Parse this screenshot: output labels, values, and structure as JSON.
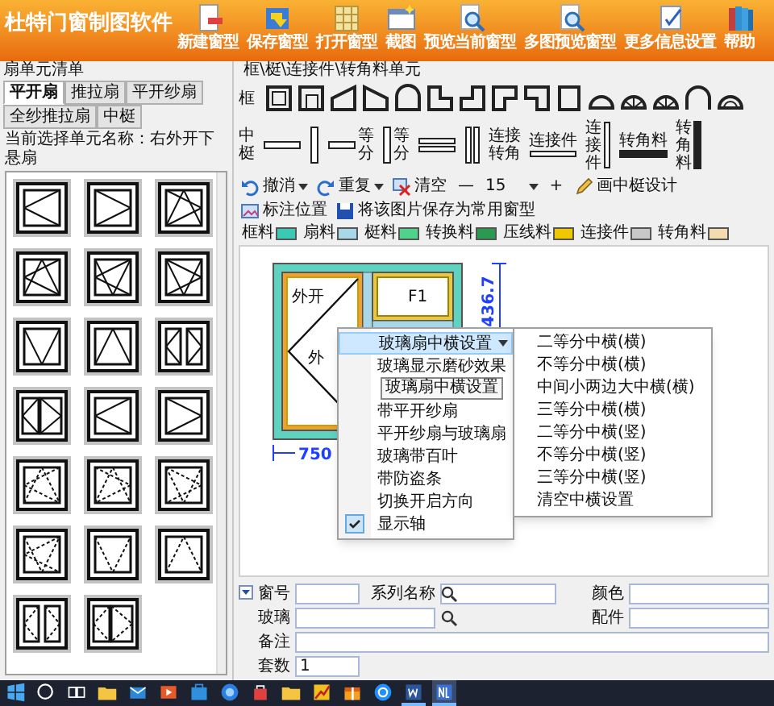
{
  "app": {
    "title": "杜特门窗制图软件"
  },
  "toolbar": [
    {
      "kind": "new",
      "label": "新建窗型"
    },
    {
      "kind": "save",
      "label": "保存窗型"
    },
    {
      "kind": "open",
      "label": "打开窗型"
    },
    {
      "kind": "screenshot",
      "label": "截图"
    },
    {
      "kind": "preview",
      "label": "预览当前窗型"
    },
    {
      "kind": "multi-preview",
      "label": "多图预览窗型"
    },
    {
      "kind": "settings",
      "label": "更多信息设置"
    },
    {
      "kind": "help",
      "label": "帮助"
    }
  ],
  "unit_panel": {
    "title": "扇单元清单",
    "tabs": [
      {
        "label": "平开扇",
        "selected": true
      },
      {
        "label": "推拉扇",
        "selected": false
      },
      {
        "label": "平开纱扇",
        "selected": false
      },
      {
        "label": "全纱推拉扇",
        "selected": false
      },
      {
        "label": "中梃",
        "selected": false
      }
    ],
    "current_unit": "当前选择单元名称：右外开下悬扇",
    "units": [
      {
        "kind": "side-left",
        "dashed": false
      },
      {
        "kind": "side-right",
        "dashed": false
      },
      {
        "kind": "tilt-right",
        "dashed": false
      },
      {
        "kind": "tilt-left",
        "dashed": false
      },
      {
        "kind": "tilt-left-b",
        "dashed": false
      },
      {
        "kind": "tilt-right-b",
        "dashed": false
      },
      {
        "kind": "bottom",
        "dashed": false
      },
      {
        "kind": "top",
        "dashed": false
      },
      {
        "kind": "double",
        "dashed": false
      },
      {
        "kind": "double-wide",
        "dashed": false
      },
      {
        "kind": "side-left",
        "dashed": false
      },
      {
        "kind": "side-right",
        "dashed": false
      },
      {
        "kind": "tilt-left",
        "dashed": true
      },
      {
        "kind": "tilt-right",
        "dashed": true
      },
      {
        "kind": "tilt-right-b",
        "dashed": true
      },
      {
        "kind": "tilt-left-b",
        "dashed": true
      },
      {
        "kind": "bottom",
        "dashed": true
      },
      {
        "kind": "top",
        "dashed": true
      },
      {
        "kind": "double",
        "dashed": true
      },
      {
        "kind": "double-wide",
        "dashed": true
      }
    ]
  },
  "parts_panel": {
    "title": "框\\梃\\连接件\\转角料单元",
    "frame_row": {
      "label": "框",
      "items": [
        {
          "kind": "rect"
        },
        {
          "kind": "rect-sill"
        },
        {
          "kind": "slope-left"
        },
        {
          "kind": "slope-right"
        },
        {
          "kind": "arch-rect"
        },
        {
          "kind": "notch-tr"
        },
        {
          "kind": "notch-tl"
        },
        {
          "kind": "notch-br"
        },
        {
          "kind": "notch-bl"
        },
        {
          "kind": "rect-tall"
        },
        {
          "kind": "half-round"
        },
        {
          "kind": "fan"
        },
        {
          "kind": "fan"
        },
        {
          "kind": "round-arch"
        },
        {
          "kind": "sunburst"
        }
      ]
    },
    "mullion_row": {
      "label": "中梃",
      "items": [
        {
          "kind": "bar-h"
        },
        {
          "kind": "bar-v"
        },
        {
          "kind": "equal-h",
          "text": "等分"
        },
        {
          "kind": "equal-v",
          "text": "等分"
        },
        {
          "kind": "double-h"
        },
        {
          "kind": "double-v"
        },
        {
          "kind": "corner-joint",
          "text": "连接转角"
        },
        {
          "kind": "connector-h",
          "text": "连接件"
        },
        {
          "kind": "connector-v",
          "text": "连接件"
        },
        {
          "kind": "corner-h",
          "text": "转角料"
        },
        {
          "kind": "corner-v",
          "text": "转角料"
        }
      ]
    }
  },
  "edit_toolbar": [
    {
      "kind": "undo",
      "label": "撤消",
      "dropdown": true
    },
    {
      "kind": "redo",
      "label": "重复",
      "dropdown": true
    },
    {
      "kind": "clear",
      "label": "清空",
      "dropdown": false
    },
    {
      "kind": "zoom",
      "minus": "—",
      "value": "15",
      "plus": "+"
    },
    {
      "kind": "design",
      "label": "画中梃设计",
      "dropdown": false
    },
    {
      "kind": "dimension",
      "label": "标注位置",
      "dropdown": false
    },
    {
      "kind": "save",
      "label": "将该图片保存为常用窗型",
      "dropdown": false
    }
  ],
  "legend": [
    {
      "label": "框料",
      "color": "#3cc9b4"
    },
    {
      "label": "扇料",
      "color": "#a8d8e8"
    },
    {
      "label": "梃料",
      "color": "#4fd28a"
    },
    {
      "label": "转换料",
      "color": "#2a9a50"
    },
    {
      "label": "压线料",
      "color": "#f0c800"
    },
    {
      "label": "连接件",
      "color": "#c8c8c8"
    },
    {
      "label": "转角料",
      "color": "#f5dcb0"
    }
  ],
  "drawing": {
    "height_dim": "436.7",
    "width_dim": "750",
    "sash_labels": [
      "外开",
      "F1",
      "外"
    ]
  },
  "context_menu": {
    "items": [
      {
        "label": "玻璃扇中横设置",
        "submenu": true,
        "selected": true,
        "checked": false
      },
      {
        "label": "玻璃显示磨砂效果",
        "submenu": false,
        "selected": false,
        "checked": false
      },
      {
        "label": "带平开纱扇",
        "submenu": false,
        "selected": false,
        "checked": false
      },
      {
        "label": "平开纱扇与玻璃扇",
        "submenu": false,
        "selected": false,
        "checked": false
      },
      {
        "label": "玻璃带百叶",
        "submenu": false,
        "selected": false,
        "checked": false
      },
      {
        "label": "带防盗条",
        "submenu": false,
        "selected": false,
        "checked": false
      },
      {
        "label": "切换开启方向",
        "submenu": false,
        "selected": false,
        "checked": false
      },
      {
        "label": "显示轴",
        "submenu": false,
        "selected": false,
        "checked": true
      }
    ],
    "tooltip": "玻璃扇中横设置",
    "submenu": [
      "二等分中横(横)",
      "不等分中横(横)",
      "中间小两边大中横(横)",
      "三等分中横(横)",
      "二等分中横(竖)",
      "不等分中横(竖)",
      "三等分中横(竖)",
      "清空中横设置"
    ]
  },
  "details": {
    "rows": [
      [
        {
          "label": "窗号"
        },
        {
          "label": "系列名称",
          "search": true
        },
        {
          "label": "颜色"
        }
      ],
      [
        {
          "label": "玻璃",
          "search": true
        },
        "",
        {
          "label": "配件"
        }
      ],
      [
        {
          "label": "备注"
        }
      ],
      [
        {
          "label": "套数",
          "value": "1"
        }
      ]
    ]
  },
  "taskbar": [
    {
      "kind": "start",
      "running": false,
      "selected": false
    },
    {
      "kind": "search",
      "running": false,
      "selected": false
    },
    {
      "kind": "task-view",
      "running": false,
      "selected": false
    },
    {
      "kind": "folder",
      "running": false,
      "selected": false
    },
    {
      "kind": "mail",
      "running": false,
      "selected": false
    },
    {
      "kind": "media",
      "running": false,
      "selected": false
    },
    {
      "kind": "store",
      "running": false,
      "selected": false
    },
    {
      "kind": "circle",
      "running": false,
      "selected": false
    },
    {
      "kind": "bag",
      "running": false,
      "selected": false
    },
    {
      "kind": "folder",
      "running": false,
      "selected": false
    },
    {
      "kind": "chart",
      "running": false,
      "selected": false
    },
    {
      "kind": "gift",
      "running": false,
      "selected": false
    },
    {
      "kind": "browser",
      "running": false,
      "selected": false
    },
    {
      "kind": "word",
      "running": true,
      "selected": false
    },
    {
      "kind": "app",
      "running": true,
      "selected": true
    }
  ]
}
